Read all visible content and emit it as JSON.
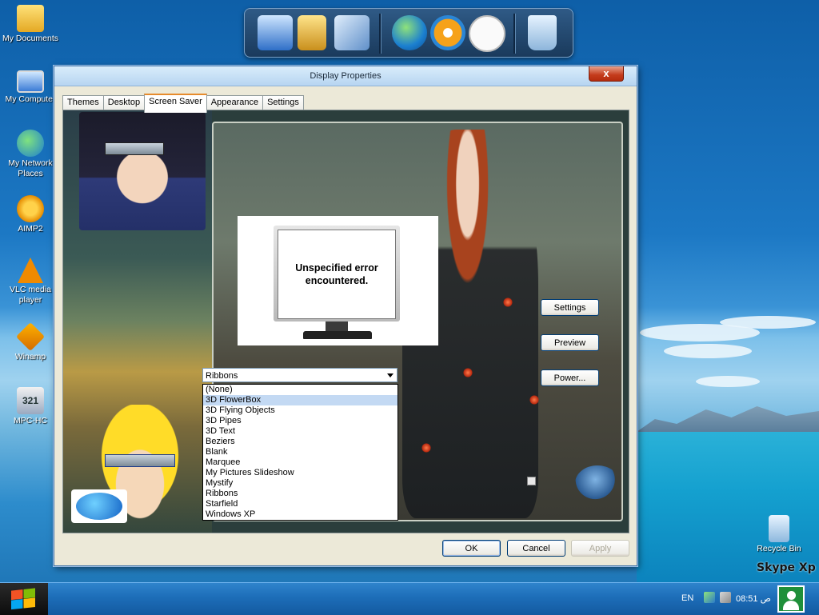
{
  "desktop": {
    "icons": [
      {
        "label": "My Documents",
        "icon": "folder-icon"
      },
      {
        "label": "My Computer",
        "icon": "computer-icon"
      },
      {
        "label": "My Network Places",
        "icon": "network-icon"
      },
      {
        "label": "AIMP2",
        "icon": "aimp-icon"
      },
      {
        "label": "VLC media player",
        "icon": "vlc-cone-icon"
      },
      {
        "label": "Winamp",
        "icon": "winamp-icon"
      },
      {
        "label": "MPC-HC",
        "icon": "mpc-icon"
      },
      {
        "label": "Recycle Bin",
        "icon": "recycle-bin-icon"
      }
    ],
    "mpc_glyph": "321",
    "brand": "Skype Xp"
  },
  "dock": {
    "items": [
      "monitor-icon",
      "folder-icon",
      "disc-icon",
      "globe-icon",
      "media-player-icon",
      "clock-icon",
      "trash-icon"
    ]
  },
  "window": {
    "title": "Display Properties",
    "close_label": "x",
    "tabs": [
      "Themes",
      "Desktop",
      "Screen Saver",
      "Appearance",
      "Settings"
    ],
    "active_tab": "Screen Saver",
    "preview_message": "Unspecified error encountered.",
    "screensaver": {
      "selected": "Ribbons",
      "options": [
        "(None)",
        "3D FlowerBox",
        "3D Flying Objects",
        "3D Pipes",
        "3D Text",
        "Beziers",
        "Blank",
        "Marquee",
        "My Pictures Slideshow",
        "Mystify",
        "Ribbons",
        "Starfield",
        "Windows XP"
      ],
      "highlighted": "3D FlowerBox"
    },
    "side_buttons": {
      "settings": "Settings",
      "preview": "Preview",
      "power": "Power..."
    },
    "footer_buttons": {
      "ok": "OK",
      "cancel": "Cancel",
      "apply": "Apply"
    }
  },
  "taskbar": {
    "language": "EN",
    "clock": "08:51 ص"
  },
  "colors": {
    "accent": "#3a6ea5",
    "tab_highlight": "#e68b2c",
    "list_selection": "#c3d9f3",
    "close_button": "#c43b1c"
  }
}
